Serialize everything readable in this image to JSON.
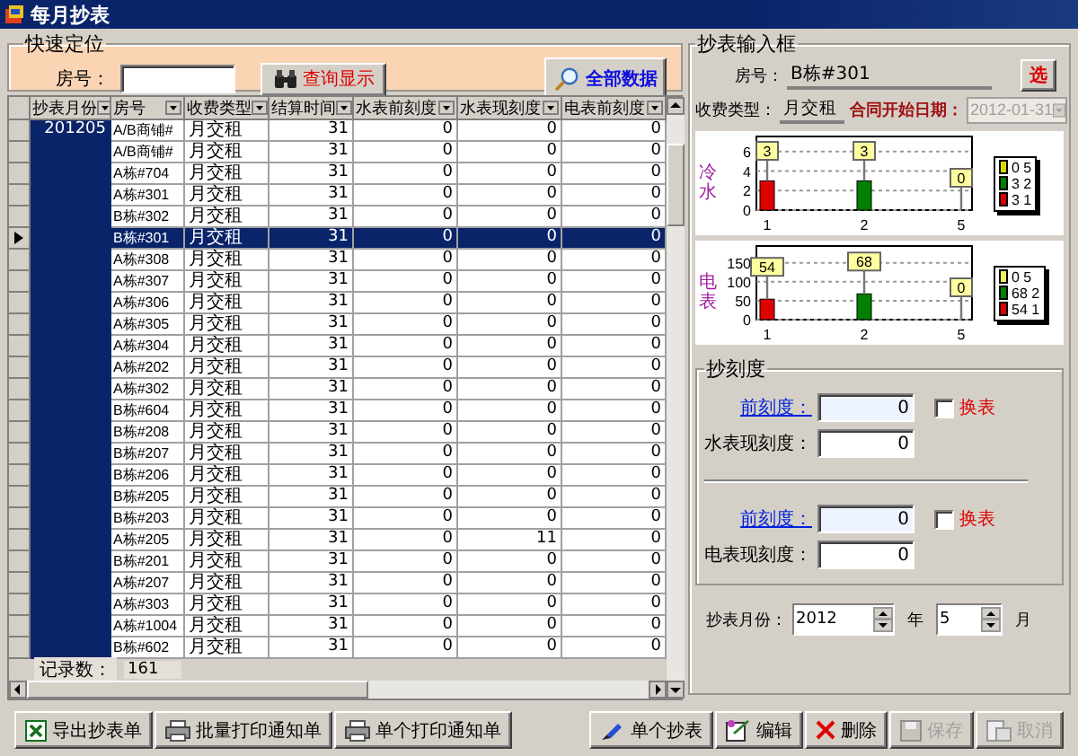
{
  "window": {
    "title": "每月抄表"
  },
  "quick_search": {
    "title": "快速定位",
    "room_label": "房号：",
    "search_button": "查询显示",
    "all_button": "全部数据"
  },
  "table": {
    "columns": [
      "抄表月份",
      "房号",
      "收费类型",
      "结算时间",
      "水表前刻度",
      "水表现刻度",
      "电表前刻度"
    ],
    "rows": [
      {
        "month": "201205",
        "room": "A/B商铺#",
        "type": "月交租",
        "days": "31",
        "water_prev": "0",
        "water_now": "0",
        "elec_prev": "0",
        "selected": false
      },
      {
        "room": "A/B商铺#",
        "type": "月交租",
        "days": "31",
        "water_prev": "0",
        "water_now": "0",
        "elec_prev": "0",
        "selected": false
      },
      {
        "room": "A栋#704",
        "type": "月交租",
        "days": "31",
        "water_prev": "0",
        "water_now": "0",
        "elec_prev": "0",
        "selected": false
      },
      {
        "room": "A栋#301",
        "type": "月交租",
        "days": "31",
        "water_prev": "0",
        "water_now": "0",
        "elec_prev": "0",
        "selected": false
      },
      {
        "room": "B栋#302",
        "type": "月交租",
        "days": "31",
        "water_prev": "0",
        "water_now": "0",
        "elec_prev": "0",
        "selected": false
      },
      {
        "room": "B栋#301",
        "type": "月交租",
        "days": "31",
        "water_prev": "0",
        "water_now": "0",
        "elec_prev": "0",
        "selected": true
      },
      {
        "room": "A栋#308",
        "type": "月交租",
        "days": "31",
        "water_prev": "0",
        "water_now": "0",
        "elec_prev": "0",
        "selected": false
      },
      {
        "room": "A栋#307",
        "type": "月交租",
        "days": "31",
        "water_prev": "0",
        "water_now": "0",
        "elec_prev": "0",
        "selected": false
      },
      {
        "room": "A栋#306",
        "type": "月交租",
        "days": "31",
        "water_prev": "0",
        "water_now": "0",
        "elec_prev": "0",
        "selected": false
      },
      {
        "room": "A栋#305",
        "type": "月交租",
        "days": "31",
        "water_prev": "0",
        "water_now": "0",
        "elec_prev": "0",
        "selected": false
      },
      {
        "room": "A栋#304",
        "type": "月交租",
        "days": "31",
        "water_prev": "0",
        "water_now": "0",
        "elec_prev": "0",
        "selected": false
      },
      {
        "room": "A栋#202",
        "type": "月交租",
        "days": "31",
        "water_prev": "0",
        "water_now": "0",
        "elec_prev": "0",
        "selected": false
      },
      {
        "room": "A栋#302",
        "type": "月交租",
        "days": "31",
        "water_prev": "0",
        "water_now": "0",
        "elec_prev": "0",
        "selected": false
      },
      {
        "room": "B栋#604",
        "type": "月交租",
        "days": "31",
        "water_prev": "0",
        "water_now": "0",
        "elec_prev": "0",
        "selected": false
      },
      {
        "room": "B栋#208",
        "type": "月交租",
        "days": "31",
        "water_prev": "0",
        "water_now": "0",
        "elec_prev": "0",
        "selected": false
      },
      {
        "room": "B栋#207",
        "type": "月交租",
        "days": "31",
        "water_prev": "0",
        "water_now": "0",
        "elec_prev": "0",
        "selected": false
      },
      {
        "room": "B栋#206",
        "type": "月交租",
        "days": "31",
        "water_prev": "0",
        "water_now": "0",
        "elec_prev": "0",
        "selected": false
      },
      {
        "room": "B栋#205",
        "type": "月交租",
        "days": "31",
        "water_prev": "0",
        "water_now": "0",
        "elec_prev": "0",
        "selected": false
      },
      {
        "room": "B栋#203",
        "type": "月交租",
        "days": "31",
        "water_prev": "0",
        "water_now": "0",
        "elec_prev": "0",
        "selected": false
      },
      {
        "room": "A栋#205",
        "type": "月交租",
        "days": "31",
        "water_prev": "0",
        "water_now": "11",
        "elec_prev": "0",
        "selected": false
      },
      {
        "room": "B栋#201",
        "type": "月交租",
        "days": "31",
        "water_prev": "0",
        "water_now": "0",
        "elec_prev": "0",
        "selected": false
      },
      {
        "room": "A栋#207",
        "type": "月交租",
        "days": "31",
        "water_prev": "0",
        "water_now": "0",
        "elec_prev": "0",
        "selected": false
      },
      {
        "room": "A栋#303",
        "type": "月交租",
        "days": "31",
        "water_prev": "0",
        "water_now": "0",
        "elec_prev": "0",
        "selected": false
      },
      {
        "room": "A栋#1004",
        "type": "月交租",
        "days": "31",
        "water_prev": "0",
        "water_now": "0",
        "elec_prev": "0",
        "selected": false
      },
      {
        "room": "B栋#602",
        "type": "月交租",
        "days": "31",
        "water_prev": "0",
        "water_now": "0",
        "elec_prev": "0",
        "selected": false
      }
    ],
    "record_count_label": "记录数：",
    "record_count": "161"
  },
  "entry": {
    "title": "抄表输入框",
    "room_label": "房号：",
    "room": "B栋#301",
    "pick_button": "选",
    "fee_type_label": "收费类型：",
    "fee_type": "月交租",
    "contract_date_label": "合同开始日期：",
    "contract_date": "2012-01-31",
    "contract_date_disabled": true,
    "charts": [
      {
        "legend": [
          {
            "label": "0 5",
            "color": "#d8d800"
          },
          {
            "label": "3 2",
            "color": "#008000"
          },
          {
            "label": "3 1",
            "color": "#e00000"
          }
        ],
        "chart_data": {
          "type": "bar",
          "ylabel": "冷水",
          "categories": [
            "1",
            "2",
            "5"
          ],
          "values": [
            3,
            3,
            0
          ],
          "ylim": [
            0,
            7
          ],
          "grid": true,
          "yticks": [
            0,
            2,
            4,
            6
          ],
          "data_labels": true
        }
      },
      {
        "legend": [
          {
            "label": "0 5",
            "color": "#f0f060"
          },
          {
            "label": "68 2",
            "color": "#008000"
          },
          {
            "label": "54 1",
            "color": "#e00000"
          }
        ],
        "chart_data": {
          "type": "bar",
          "ylabel": "电表",
          "categories": [
            "1",
            "2",
            "5"
          ],
          "values": [
            54,
            68,
            0
          ],
          "ylim": [
            0,
            180
          ],
          "grid": true,
          "yticks": [
            0,
            50,
            100,
            150
          ],
          "data_labels": true
        }
      }
    ],
    "reading": {
      "title": "抄刻度",
      "meters": [
        {
          "prev_label": "前刻度：",
          "prev": "0",
          "swap_label": "换表",
          "swap_checked": false,
          "now_label": "水表现刻度：",
          "now": "0"
        },
        {
          "prev_label": "前刻度：",
          "prev": "0",
          "swap_label": "换表",
          "swap_checked": false,
          "now_label": "电表现刻度：",
          "now": "0"
        }
      ]
    },
    "month_label": "抄表月份：",
    "year": "2012",
    "year_unit": "年",
    "month": "5",
    "month_unit": "月"
  },
  "left_buttons": [
    {
      "label": "导出抄表单",
      "kind": "excel",
      "disabled": false
    },
    {
      "label": "批量打印通知单",
      "kind": "print",
      "disabled": false
    },
    {
      "label": "单个打印通知单",
      "kind": "print",
      "disabled": false
    }
  ],
  "right_buttons": [
    {
      "label": "单个抄表",
      "kind": "pen",
      "disabled": false
    },
    {
      "label": "编辑",
      "kind": "edit",
      "disabled": false
    },
    {
      "label": "删除",
      "kind": "delete",
      "disabled": false
    },
    {
      "label": "保存",
      "kind": "save",
      "disabled": true
    },
    {
      "label": "取消",
      "kind": "cancel",
      "disabled": true
    }
  ]
}
